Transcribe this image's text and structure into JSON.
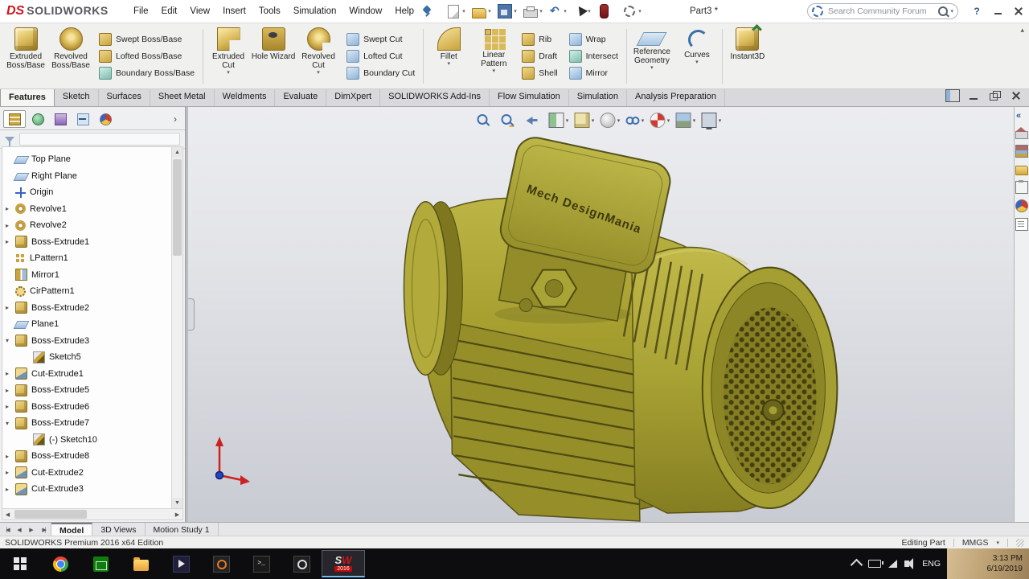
{
  "titlebar": {
    "logo_ds": "DS",
    "logo_text": "SOLIDWORKS",
    "menus": [
      {
        "label": "File",
        "dn": "menu-file"
      },
      {
        "label": "Edit",
        "dn": "menu-edit"
      },
      {
        "label": "View",
        "dn": "menu-view"
      },
      {
        "label": "Insert",
        "dn": "menu-insert"
      },
      {
        "label": "Tools",
        "dn": "menu-tools"
      },
      {
        "label": "Simulation",
        "dn": "menu-simulation"
      },
      {
        "label": "Window",
        "dn": "menu-window"
      },
      {
        "label": "Help",
        "dn": "menu-help"
      }
    ],
    "quick_access": [
      {
        "name": "new-document-button",
        "icon": "qi-new",
        "caret": "has-caret"
      },
      {
        "name": "open-button",
        "icon": "qi-open",
        "caret": "has-caret"
      },
      {
        "name": "save-button",
        "icon": "qi-save",
        "caret": "has-caret"
      },
      {
        "name": "print-button",
        "icon": "qi-print",
        "caret": "has-caret"
      },
      {
        "name": "undo-button",
        "icon": "qi-undo",
        "caret": "has-caret"
      },
      {
        "name": "select-button",
        "icon": "qi-select",
        "caret": "has-caret"
      },
      {
        "name": "rebuild-button",
        "icon": "qi-rebuild"
      },
      {
        "name": "options-button",
        "icon": "qi-options",
        "caret": "has-caret"
      }
    ],
    "doc_title": "Part3 *",
    "search_placeholder": "Search Community Forum",
    "help_label": "?"
  },
  "ribbon": {
    "buttons": {
      "extruded_boss": "Extruded Boss/Base",
      "revolved_boss": "Revolved Boss/Base",
      "swept_boss": "Swept Boss/Base",
      "lofted_boss": "Lofted Boss/Base",
      "boundary_boss": "Boundary Boss/Base",
      "extruded_cut": "Extruded Cut",
      "hole_wizard": "Hole Wizard",
      "revolved_cut": "Revolved Cut",
      "swept_cut": "Swept Cut",
      "lofted_cut": "Lofted Cut",
      "boundary_cut": "Boundary Cut",
      "fillet": "Fillet",
      "linear_pattern": "Linear Pattern",
      "rib": "Rib",
      "draft": "Draft",
      "shell": "Shell",
      "wrap": "Wrap",
      "intersect": "Intersect",
      "mirror": "Mirror",
      "reference_geometry": "Reference Geometry",
      "curves": "Curves",
      "instant3d": "Instant3D"
    }
  },
  "ribbon_tabs": [
    {
      "label": "Features",
      "dn": "tab-features",
      "state": "active"
    },
    {
      "label": "Sketch",
      "dn": "tab-sketch"
    },
    {
      "label": "Surfaces",
      "dn": "tab-surfaces"
    },
    {
      "label": "Sheet Metal",
      "dn": "tab-sheet-metal"
    },
    {
      "label": "Weldments",
      "dn": "tab-weldments"
    },
    {
      "label": "Evaluate",
      "dn": "tab-evaluate"
    },
    {
      "label": "DimXpert",
      "dn": "tab-dimxpert"
    },
    {
      "label": "SOLIDWORKS Add-Ins",
      "dn": "tab-solidworks-add-ins"
    },
    {
      "label": "Flow Simulation",
      "dn": "tab-flow-simulation"
    },
    {
      "label": "Simulation",
      "dn": "tab-simulation"
    },
    {
      "label": "Analysis Preparation",
      "dn": "tab-analysis-preparation"
    }
  ],
  "feature_tree": {
    "items": [
      {
        "label": "Top Plane",
        "icon": "plane"
      },
      {
        "label": "Right Plane",
        "icon": "plane"
      },
      {
        "label": "Origin",
        "icon": "origin"
      },
      {
        "label": "Revolve1",
        "icon": "revolve",
        "twist": "collapsed"
      },
      {
        "label": "Revolve2",
        "icon": "revolve",
        "twist": "collapsed"
      },
      {
        "label": "Boss-Extrude1",
        "icon": "extrude",
        "twist": "collapsed"
      },
      {
        "label": "LPattern1",
        "icon": "lpattern"
      },
      {
        "label": "Mirror1",
        "icon": "mirrorf"
      },
      {
        "label": "CirPattern1",
        "icon": "cirpattern"
      },
      {
        "label": "Boss-Extrude2",
        "icon": "extrude",
        "twist": "collapsed"
      },
      {
        "label": "Plane1",
        "icon": "plane"
      },
      {
        "label": "Boss-Extrude3",
        "icon": "extrude",
        "twist": "expanded"
      },
      {
        "label": "Sketch5",
        "icon": "sketch",
        "ind": "ind1"
      },
      {
        "label": "Cut-Extrude1",
        "icon": "cutx",
        "twist": "collapsed"
      },
      {
        "label": "Boss-Extrude5",
        "icon": "extrude",
        "twist": "collapsed"
      },
      {
        "label": "Boss-Extrude6",
        "icon": "extrude",
        "twist": "collapsed"
      },
      {
        "label": "Boss-Extrude7",
        "icon": "extrude",
        "twist": "expanded"
      },
      {
        "label": "(-) Sketch10",
        "icon": "sketch",
        "ind": "ind1"
      },
      {
        "label": "Boss-Extrude8",
        "icon": "extrude",
        "twist": "collapsed"
      },
      {
        "label": "Cut-Extrude2",
        "icon": "cutx",
        "twist": "collapsed"
      },
      {
        "label": "Cut-Extrude3",
        "icon": "cutx",
        "twist": "collapsed"
      }
    ]
  },
  "hud": {
    "icons": [
      {
        "name": "zoom-fit-button",
        "icon": "hi-zoomfit"
      },
      {
        "name": "zoom-area-button",
        "icon": "hi-zoomarea"
      },
      {
        "name": "previous-view-button",
        "icon": "hi-prev"
      },
      {
        "name": "section-view-button",
        "icon": "hi-section",
        "caret": "has-caret"
      },
      {
        "name": "view-orientation-button",
        "icon": "hi-cube",
        "caret": "has-caret"
      },
      {
        "name": "display-style-button",
        "icon": "hi-display",
        "caret": "has-caret"
      },
      {
        "name": "hide-show-items-button",
        "icon": "hi-hideshow",
        "caret": "has-caret"
      },
      {
        "name": "edit-appearance-button",
        "icon": "hi-ball",
        "caret": "has-caret"
      },
      {
        "name": "apply-scene-button",
        "icon": "hi-scene",
        "caret": "has-caret"
      },
      {
        "name": "view-settings-button",
        "icon": "hi-settings",
        "caret": "has-caret"
      }
    ]
  },
  "task_pane": {
    "icons": [
      {
        "name": "task-pane-collapse",
        "icon": "tp-collapse"
      },
      {
        "name": "solidworks-resources",
        "icon": "tp-home"
      },
      {
        "name": "design-library",
        "icon": "tp-library"
      },
      {
        "name": "file-explorer",
        "icon": "tp-folder"
      },
      {
        "name": "view-palette",
        "icon": "tp-palette"
      },
      {
        "name": "appearances-scenes",
        "icon": "tp-ball"
      },
      {
        "name": "custom-properties",
        "icon": "tp-props"
      }
    ]
  },
  "viewport": {
    "model_text": "Mech DesignMania"
  },
  "bottom_tabs": [
    {
      "label": "Model",
      "dn": "model-tab",
      "state": "active"
    },
    {
      "label": "3D Views",
      "dn": "3d-views-tab"
    },
    {
      "label": "Motion Study 1",
      "dn": "motion-study-1-tab"
    }
  ],
  "statusbar": {
    "left": "SOLIDWORKS Premium 2016 x64 Edition",
    "editing": "Editing Part",
    "units": "MMGS"
  },
  "taskbar": {
    "icons": [
      {
        "name": "taskbar-start",
        "icon": "tk-start"
      },
      {
        "name": "taskbar-chrome",
        "icon": "tk-chrome"
      },
      {
        "name": "taskbar-store",
        "icon": "tk-store"
      },
      {
        "name": "taskbar-file-explorer",
        "icon": "tk-explorer"
      },
      {
        "name": "taskbar-video-app",
        "icon": "tk-video"
      },
      {
        "name": "taskbar-music-app",
        "icon": "tk-music"
      },
      {
        "name": "taskbar-console",
        "icon": "tk-console"
      },
      {
        "name": "taskbar-camera",
        "icon": "tk-camera"
      }
    ],
    "solidworks": {
      "s": "S",
      "w": "W",
      "year": "2016"
    },
    "lang": "ENG",
    "time": "3:13 PM",
    "date": "6/19/2019"
  }
}
